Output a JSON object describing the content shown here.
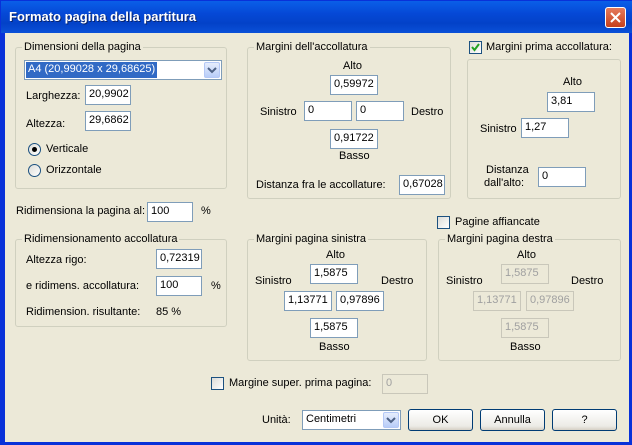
{
  "window": {
    "title": "Formato pagina della partitura"
  },
  "page_dims": {
    "group_title": "Dimensioni della pagina",
    "paper_value": "A4 (20,99028 x 29,68625)",
    "width_label": "Larghezza:",
    "width_value": "20,9902",
    "height_label": "Altezza:",
    "height_value": "29,6862",
    "portrait_label": "Verticale",
    "landscape_label": "Orizzontale",
    "orientation_selected": "Verticale"
  },
  "system_margins": {
    "group_title": "Margini dell'accollatura",
    "top_label": "Alto",
    "top_value": "0,59972",
    "left_label": "Sinistro",
    "left_value": "0",
    "right_label": "Destro",
    "right_value": "0",
    "bottom_label": "Basso",
    "bottom_value": "0,91722",
    "distance_label": "Distanza fra le accollature:",
    "distance_value": "0,67028"
  },
  "first_system": {
    "checkbox_label": "Margini prima accollatura:",
    "checked": true,
    "top_label": "Alto",
    "top_value": "3,81",
    "left_label": "Sinistro",
    "left_value": "1,27",
    "distance_label_line1": "Distanza",
    "distance_label_line2": "dall'alto:",
    "distance_value": "0"
  },
  "resize": {
    "label": "Ridimensiona la pagina al:",
    "value": "100",
    "unit": "%"
  },
  "system_scaling": {
    "group_title": "Ridimensionamento accollatura",
    "staff_height_label": "Altezza rigo:",
    "staff_height_value": "0,72319",
    "scale_label": "e ridimens. accollatura:",
    "scale_value": "100",
    "scale_unit": "%",
    "result_label": "Ridimension. risultante:",
    "result_value": "85 %"
  },
  "facing": {
    "label": "Pagine affiancate",
    "checked": false
  },
  "left_page": {
    "group_title": "Margini pagina sinistra",
    "top_label": "Alto",
    "top_value": "1,5875",
    "left_label": "Sinistro",
    "left_value": "1,13771",
    "right_label": "Destro",
    "right_value": "0,97896",
    "bottom_label": "Basso",
    "bottom_value": "1,5875"
  },
  "right_page": {
    "group_title": "Margini pagina destra",
    "top_label": "Alto",
    "top_value": "1,5875",
    "left_label": "Sinistro",
    "left_value": "1,13771",
    "right_label": "Destro",
    "right_value": "0,97896",
    "bottom_label": "Basso",
    "bottom_value": "1,5875"
  },
  "first_page": {
    "label": "Margine super. prima pagina:",
    "value": "0",
    "checked": false
  },
  "footer": {
    "units_label": "Unità:",
    "units_value": "Centimetri",
    "ok": "OK",
    "cancel": "Annulla",
    "help": "?"
  },
  "colors": {
    "title_bar": "#0548d6",
    "dialog_bg": "#ece9d8",
    "selection": "#316ac5"
  },
  "icons": [
    "close-icon",
    "check-icon",
    "chevron-down-icon"
  ]
}
